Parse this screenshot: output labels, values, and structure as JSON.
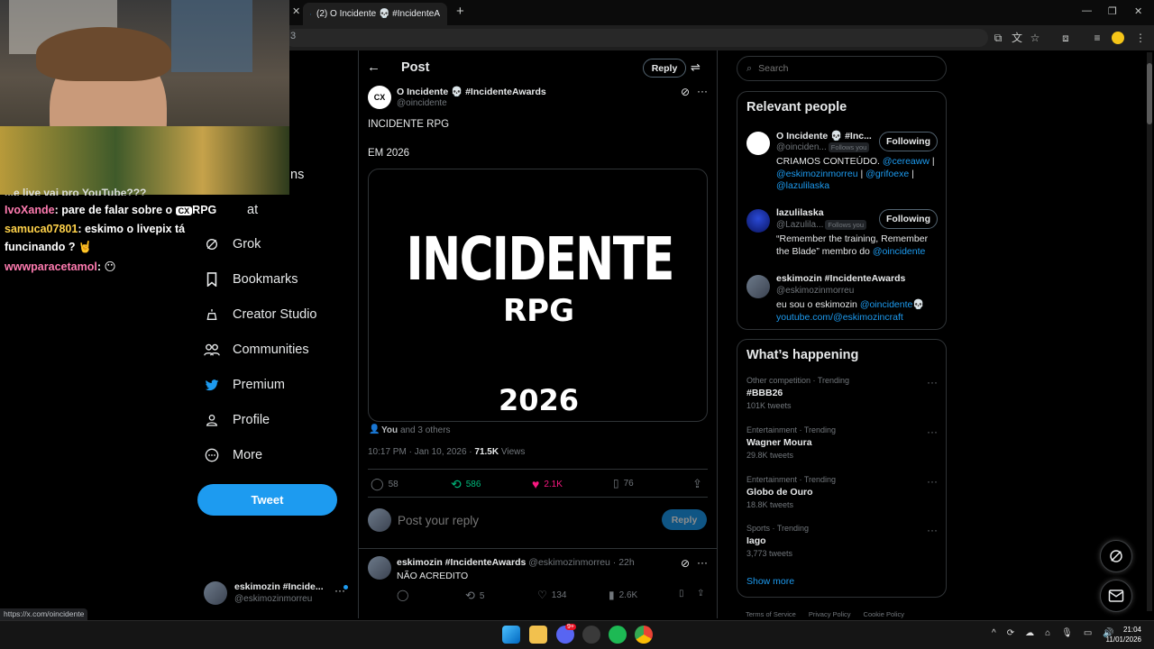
{
  "browser": {
    "tab_title": "(2) O Incidente 💀 #IncidenteA",
    "address_fragment": "3",
    "status_url": "https://x.com/oincidente"
  },
  "sidebar": {
    "partial_items": [
      "ns",
      "at"
    ],
    "items": [
      {
        "label": "Grok",
        "icon": "grok-icon"
      },
      {
        "label": "Bookmarks",
        "icon": "bookmark-icon"
      },
      {
        "label": "Creator Studio",
        "icon": "creator-studio-icon"
      },
      {
        "label": "Communities",
        "icon": "communities-icon"
      },
      {
        "label": "Premium",
        "icon": "twitter-bird-icon"
      },
      {
        "label": "Profile",
        "icon": "person-icon"
      },
      {
        "label": "More",
        "icon": "more-circle-icon"
      }
    ],
    "tweet_button": "Tweet",
    "account": {
      "name": "eskimozin #Incide...",
      "handle": "@eskimozinmorreu"
    }
  },
  "post": {
    "header": "Post",
    "reply_button": "Reply",
    "author_name": "O Incidente 💀 #IncidenteAwards",
    "author_handle": "@oincidente",
    "text_line1": "INCIDENTE RPG",
    "text_line2": "EM 2026",
    "media": {
      "title": "INCIDENTE",
      "subtitle": "RPG",
      "year": "2026"
    },
    "liked_by_you": "You",
    "liked_by_others": "and 3 others",
    "timestamp": "10:17 PM · Jan 10, 2026 · ",
    "views_count": "71.5K",
    "views_label": " Views",
    "stats": {
      "replies": "58",
      "retweets": "586",
      "likes": "2.1K",
      "bookmarks": "76"
    },
    "reply_placeholder": "Post your reply",
    "reply_submit": "Reply"
  },
  "replies": [
    {
      "name": "eskimozin #IncidenteAwards",
      "handle": "@eskimozinmorreu · 22h",
      "text": "NÃO ACREDITO",
      "replies": "",
      "retweets": "5",
      "likes": "134",
      "views": "2.6K"
    }
  ],
  "right": {
    "search_placeholder": "Search",
    "relevant_title": "Relevant people",
    "people": [
      {
        "name": "O Incidente 💀 #Inc...",
        "handle": "@oinciden...",
        "follows_you": "Follows you",
        "button": "Following",
        "bio_plain1": "CRIAMOS CONTEÚDO. ",
        "bio_link1": "@cereaww",
        "bio_plain2": " |",
        "bio_link2": "@eskimozinmorreu",
        "bio_plain3": " | ",
        "bio_link3": "@grifoexe",
        "bio_plain4": " |",
        "bio_link4": "@lazulilaska"
      },
      {
        "name": "lazulilaska",
        "handle": "@Lazulila...",
        "follows_you": "Follows you",
        "button": "Following",
        "bio_plain1": "“Remember the training, Remember the Blade” membro do ",
        "bio_link1": "@oincidente"
      },
      {
        "name": "eskimozin #IncidenteAwards",
        "handle": "@eskimozinmorreu",
        "bio_plain1": "eu sou o eskimozin ",
        "bio_link1": "@oincidente💀",
        "bio_link2": "youtube.com/@eskimozincraft"
      }
    ],
    "happening_title": "What’s happening",
    "trends": [
      {
        "category": "Other competition · Trending",
        "name": "#BBB26",
        "count": "101K tweets"
      },
      {
        "category": "Entertainment · Trending",
        "name": "Wagner Moura",
        "count": "29.8K tweets"
      },
      {
        "category": "Entertainment · Trending",
        "name": "Globo de Ouro",
        "count": "18.8K tweets"
      },
      {
        "category": "Sports · Trending",
        "name": "Iago",
        "count": "3,773 tweets"
      }
    ],
    "show_more": "Show more",
    "footer": [
      "Terms of Service",
      "Privacy Policy",
      "Cookie Policy"
    ]
  },
  "chat": [
    {
      "user": "IvoXande",
      "color": "#ff7bb0",
      "message": "pare de falar sobre o ",
      "badge": "RPG"
    },
    {
      "user": "samuca07801",
      "color": "#ffd24a",
      "message": "eskimo o livepix tá",
      "message2": "funcinando ? 🤘"
    },
    {
      "user": "wwwparacetamol",
      "color": "#ff7bb0",
      "message": "😶"
    }
  ],
  "chat_partial": "...e live vai pro YouTube???",
  "taskbar": {
    "time": "21:04",
    "date": "11/01/2026",
    "badge": "9+"
  }
}
